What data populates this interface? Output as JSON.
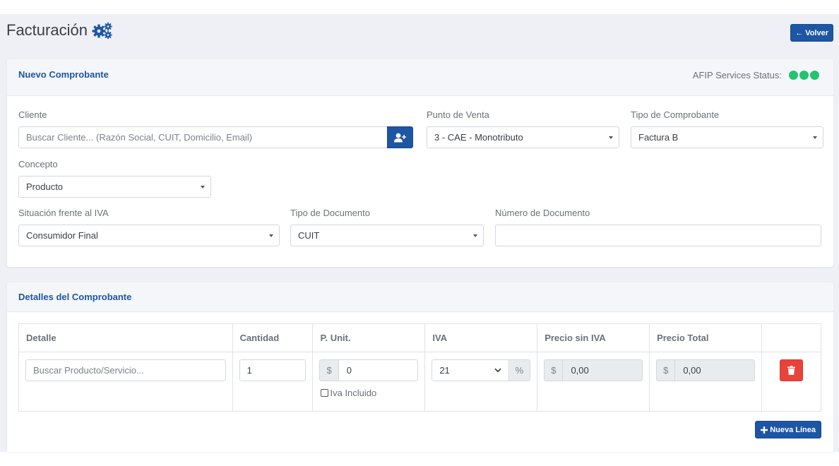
{
  "header": {
    "title": "Facturación",
    "back_label": "Volver"
  },
  "comprobante": {
    "title": "Nuevo Comprobante",
    "afip_status_label": "AFIP Services Status:",
    "status_color": "#23c46f",
    "cliente": {
      "label": "Cliente",
      "placeholder": "Buscar Cliente... (Razón Social, CUIT, Domicilio, Email)",
      "add_icon": "user-plus-icon"
    },
    "punto_venta": {
      "label": "Punto de Venta",
      "value": "3 - CAE - Monotributo"
    },
    "tipo_comprobante": {
      "label": "Tipo de Comprobante",
      "value": "Factura B"
    },
    "concepto": {
      "label": "Concepto",
      "value": "Producto"
    },
    "situacion_iva": {
      "label": "Situación frente al IVA",
      "value": "Consumidor Final"
    },
    "tipo_documento": {
      "label": "Tipo de Documento",
      "value": "CUIT"
    },
    "numero_documento": {
      "label": "Número de Documento",
      "value": ""
    }
  },
  "detalles": {
    "title": "Detalles del Comprobante",
    "columns": [
      "Detalle",
      "Cantidad",
      "P. Unit.",
      "IVA",
      "Precio sin IVA",
      "Precio Total"
    ],
    "row": {
      "detalle_placeholder": "Buscar Producto/Servicio...",
      "cantidad": "1",
      "currency_symbol": "$",
      "precio_unitario": "0",
      "iva_incluido_label": "Iva Incluido",
      "iva": "21",
      "percent_symbol": "%",
      "precio_sin_iva": "0,00",
      "precio_total": "0,00"
    },
    "new_line_label": "Nueva Línea",
    "accent_color": "#1d56a3",
    "danger_color": "#e8433a"
  }
}
